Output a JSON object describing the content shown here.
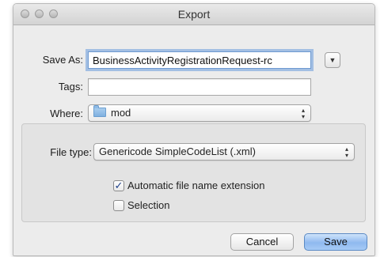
{
  "window": {
    "title": "Export"
  },
  "icons": {
    "close": "close-light",
    "minimize": "minimize-light",
    "zoom": "zoom-light",
    "folder": "folder-icon",
    "expand": "triangle-down-icon",
    "popup_arrows": "up-down-arrows-icon",
    "check": "checkmark"
  },
  "save_as": {
    "label": "Save As:",
    "value": "BusinessActivityRegistrationRequest-rc",
    "expand_glyph": "▼"
  },
  "tags": {
    "label": "Tags:",
    "value": ""
  },
  "where": {
    "label": "Where:",
    "value": "mod",
    "arrows": "▲\n▼"
  },
  "file_type": {
    "label": "File type:",
    "value": "Genericode SimpleCodeList (.xml)",
    "arrows": "▲\n▼"
  },
  "options": [
    {
      "label": "Automatic file name extension",
      "checked": true,
      "mark": "✓"
    },
    {
      "label": "Selection",
      "checked": false,
      "mark": ""
    }
  ],
  "buttons": {
    "cancel": "Cancel",
    "save": "Save"
  },
  "colors": {
    "focus_ring": "#689bdc",
    "default_button": "#8fb9ef"
  }
}
